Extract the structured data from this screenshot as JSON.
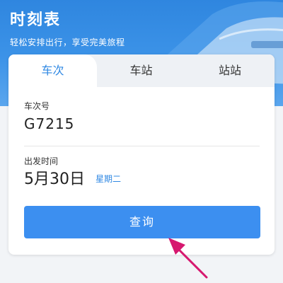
{
  "header": {
    "title": "时刻表",
    "subtitle": "轻松安排出行，享受完美旅程"
  },
  "tabs": [
    {
      "label": "车次",
      "active": true
    },
    {
      "label": "车站",
      "active": false
    },
    {
      "label": "站站",
      "active": false
    }
  ],
  "form": {
    "train_label": "车次号",
    "train_value": "G7215",
    "date_label": "出发时间",
    "date_value": "5月30日",
    "weekday": "星期二",
    "query_label": "查询"
  },
  "colors": {
    "accent": "#2f88e3",
    "button": "#3c8ff0",
    "arrow": "#d6186f"
  }
}
